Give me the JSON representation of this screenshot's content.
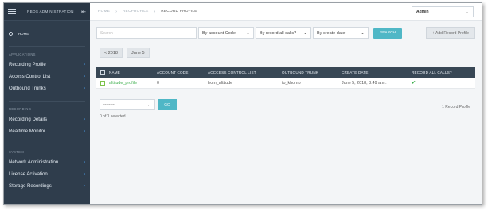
{
  "sidebar": {
    "title": "RBOS ADMINISTRATION",
    "home_label": "HOME",
    "sections": [
      {
        "label": "APPLICATIONS",
        "items": [
          "Recording Profile",
          "Access Control List",
          "Outbound Trunks"
        ]
      },
      {
        "label": "RECORDING",
        "items": [
          "Recording Details",
          "Realtime Monitor"
        ]
      },
      {
        "label": "SYSTEM",
        "items": [
          "Network Administration",
          "License Activation",
          "Storage Recordings"
        ]
      }
    ]
  },
  "header": {
    "breadcrumb": [
      "HOME",
      "RECPROFILE",
      "RECORD PROFILE"
    ],
    "user": "Admin"
  },
  "filters": {
    "search_placeholder": "Search",
    "account_code": "By account Code",
    "record_all": "By record all calls?",
    "create_date": "By create date",
    "search_button": "SEARCH",
    "add_button": "+ Add Record Profile"
  },
  "chips": [
    "< 2018",
    "June 5"
  ],
  "table": {
    "columns": [
      "NAME",
      "ACCOUNT CODE",
      "ACCCESS CONTROL LIST",
      "OUTBOUND TRUNK",
      "CREATE DATE",
      "RECORD ALL CALLS?"
    ],
    "rows": [
      {
        "name": "altitude_profile",
        "account_code": "0",
        "acl": "from_altitude",
        "trunk": "to_khomp",
        "created": "June 5, 2018, 3:49 a.m.",
        "record_all": "✔"
      }
    ]
  },
  "bulk": {
    "action_value": "---------",
    "go_button": "GO",
    "selected_text": "0 of 1 selected",
    "record_count": "1 Record Profile"
  }
}
